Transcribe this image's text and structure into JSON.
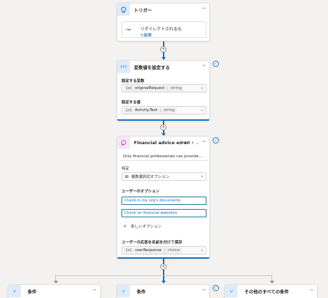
{
  "trigger": {
    "title": "トリガー",
    "icon": "lightbulb-icon",
    "redirect_label": "リダイレクトされる元",
    "edit_link": "編集"
  },
  "set_variable": {
    "title": "変数値を設定する",
    "var_label": "設定する変数",
    "var_name": "originalRequest",
    "var_type": "string",
    "value_label": "設定する値",
    "value_name": "Activity.Text",
    "value_type": "string",
    "var_symbol": "{x}"
  },
  "question": {
    "title": "Financial advice error",
    "type_label": "テキスト",
    "message": "Only financial professionals can provide...",
    "identify_label": "特定",
    "identify_value": "複数選択式オプション",
    "options_label": "ユーザーのオプション",
    "options": [
      "Check in my org's documents",
      "Check on financial websites"
    ],
    "new_option": "新しいオプション",
    "save_label": "ユーザーの応答を名前を付けて保存",
    "save_var": "userResponse",
    "save_type": "choice"
  },
  "conditions": {
    "left": "条件",
    "center": "条件",
    "right": "その他のすべての条件"
  },
  "colors": {
    "accent": "#0f6cbd",
    "canvas": "#f3f2f1",
    "question_icon": "#c239b3"
  }
}
